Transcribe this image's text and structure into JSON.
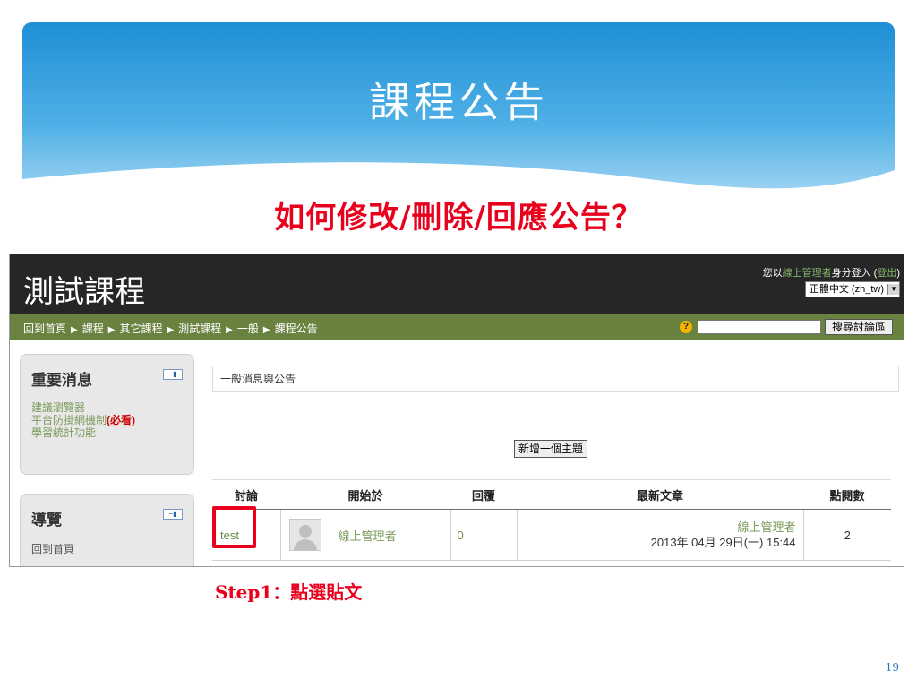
{
  "slide": {
    "title": "課程公告",
    "subtitle": "如何修改/刪除/回應公告？",
    "step_caption": "Step1：點選貼文",
    "page_number": "19",
    "colors": {
      "banner": "#1f8fd6",
      "accent_red": "#e8001c"
    }
  },
  "moodle": {
    "course_title": "測試課程",
    "login": {
      "prefix": "您以",
      "user": "線上管理者",
      "middle": "身分登入 (",
      "logout": "登出",
      "suffix": ")"
    },
    "language": "正體中文 (zh_tw)",
    "breadcrumb": [
      "回到首頁",
      "課程",
      "其它課程",
      "測試課程",
      "一般",
      "課程公告"
    ],
    "breadcrumb_separator": "▶",
    "search_button": "搜尋討論區",
    "blocks": {
      "news": {
        "title": "重要消息",
        "links": [
          "建議瀏覽器",
          "平台防掛網機制",
          "學習統計功能"
        ],
        "must_read": "(必看)"
      },
      "navigation": {
        "title": "導覽",
        "links": [
          "回到首頁"
        ]
      }
    },
    "forum_description": "一般消息與公告",
    "new_topic_button": "新增一個主題",
    "table": {
      "headers": [
        "討論",
        "開始於",
        "回覆",
        "最新文章",
        "點閱數"
      ],
      "rows": [
        {
          "discussion": "test",
          "started_by": "線上管理者",
          "replies": "0",
          "latest_author": "線上管理者",
          "latest_date": "2013年 04月 29日(一) 15:44",
          "views": "2"
        }
      ]
    }
  }
}
